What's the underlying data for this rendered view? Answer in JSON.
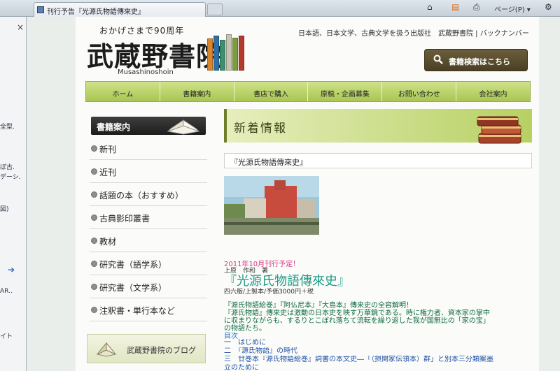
{
  "browser": {
    "tab_title": "刊行予告『光源氏物語傳來史』",
    "toolbar": {
      "home": "⌂",
      "feed": "▤",
      "print": "⎙",
      "page": "ページ(P) ▾",
      "tools": "⚙"
    }
  },
  "sidepane": {
    "close": "×",
    "fragments": [
      "全型.",
      "ぼ古.",
      "デーシ.",
      "図)",
      "AR..",
      "イト"
    ],
    "arrow": "➔"
  },
  "site": {
    "logo": {
      "tagline": "おかげさまで90周年",
      "name": "武蔵野書院",
      "romaji": "Musashinoshoin"
    },
    "header_links": "日本語、日本文学、古典文学を扱う出版社　武蔵野書院 | バックナンバー",
    "search_button": "書籍検索はこちら",
    "nav": [
      "ホーム",
      "書籍案内",
      "書店で購入",
      "原稿・企画募集",
      "お問い合わせ",
      "会社案内"
    ],
    "menu_title": "書籍案内",
    "menu": [
      "新刊",
      "近刊",
      "話題の本（おすすめ）",
      "古典影印叢書",
      "教材",
      "研究書（語学系）",
      "研究書（文学系）",
      "注釈書・単行本など"
    ],
    "blog": "武蔵野書院のブログ",
    "news": {
      "heading": "新着情報",
      "entry": "『光源氏物語傳來史』",
      "release": "2011年10月刊行予定！",
      "author": "上原　作和　著",
      "title": "『光源氏物語傳來史』",
      "specs": "四六版/上製本/予価3000円＋税",
      "desc": [
        "『源氏物語絵巻』『阿仏尼本』『大島本』傳来史の全容解明！",
        "『源氏物語』傳來史は激動の日本史を映す万華鏡である。時に権力者、資本家の掌中",
        "に収まりながらも、するりとこぼれ落ちて流転を繰り返した我が国無比の「家の宝」",
        "の物語たち。"
      ],
      "toc_label": "目次",
      "toc": [
        "一　はじめに",
        "二　『源氏物語』の時代",
        "三　廿巻本『源氏物語絵巻』詞書の本文史―「（摂関家伝領本）群」と別本三分類案墨",
        "立のために"
      ]
    }
  }
}
